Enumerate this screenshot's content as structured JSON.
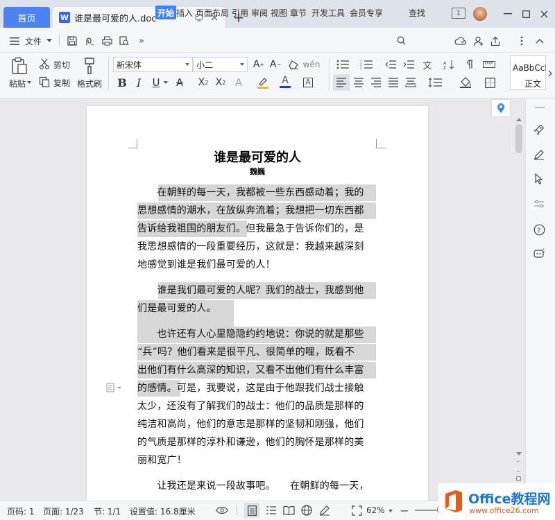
{
  "tabs": {
    "home_label": "首页",
    "doc_icon": "W",
    "doc_name": "谁是最可爱的人.doc",
    "new_tab_label": "+"
  },
  "window": {
    "page_count_badge": "1"
  },
  "menu": {
    "file_label": "文件",
    "items": [
      "开始",
      "插入",
      "页面布局",
      "引用",
      "审阅",
      "视图",
      "章节",
      "开发工具",
      "会员专享"
    ],
    "search_label": "查找"
  },
  "ribbon": {
    "paste_label": "粘贴",
    "cut_label": "剪切",
    "copy_label": "复制",
    "format_painter_label": "格式刷",
    "font_name": "新宋体",
    "font_size": "小二",
    "style_preview": "AaBbCcI",
    "style_name": "正文"
  },
  "document": {
    "title": "谁是最可爱的人",
    "author": "魏巍",
    "lines": [
      "　　在朝鲜的每一天，我都被一些东西感动着；我的",
      "思想感情的潮水，在放纵奔流着；我想把一切东西都",
      "告诉给我祖国的朋友们。但我最急于告诉你们的，是",
      "我思想感情的一段重要经历，这就是：我越来越深刻",
      "地感觉到谁是我们最可爱的人！",
      "　　谁是我们最可爱的人呢？我们的战士，我感到他",
      "们是最可爱的人。",
      "　　也许还有人心里隐隐约约地说：你说的就是那些",
      "“兵”吗？他们看来是很平凡、很简单的哩，既看不",
      "出他们有什么高深的知识，又看不出他们有什么丰富",
      "的感情。可是，我要说，这是由于他跟我们战士接触",
      "太少，还没有了解我们的战士：他们的品质是那样的",
      "纯洁和高尚，他们的意志是那样的坚韧和刚强，他们",
      "的气质是那样的淳朴和谦逊，他们的胸怀是那样的美",
      "丽和宽广！",
      "　　让我还是来说一段故事吧。　　在朝鲜的每一天，"
    ]
  },
  "status": {
    "page_num": "页码: 1",
    "page_of": "页面: 1/23",
    "section": "节: 1/1",
    "setting": "设置值: 16.8厘米",
    "zoom": "62%"
  },
  "watermark": {
    "brand": "Office教程网",
    "url": "www.office26.com"
  },
  "colors": {
    "accent": "#3e82f4",
    "highlight": "#d7d7d7",
    "watermark_orange": "#e85a16"
  }
}
